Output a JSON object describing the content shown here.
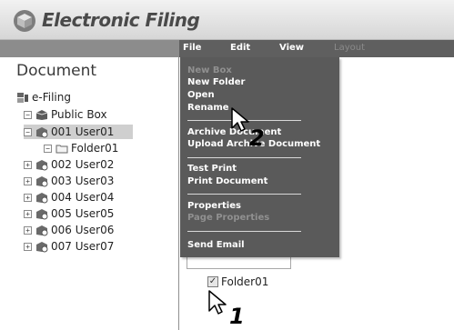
{
  "app": {
    "title": "Electronic Filing"
  },
  "menubar": {
    "items": [
      {
        "label": "File",
        "enabled": true
      },
      {
        "label": "Edit",
        "enabled": true
      },
      {
        "label": "View",
        "enabled": true
      },
      {
        "label": "Layout",
        "enabled": false
      }
    ]
  },
  "tree": {
    "heading": "Document",
    "root": "e-Filing",
    "public_box": "Public Box",
    "user01": "001 User01",
    "folder01": "Folder01",
    "user02": "002 User02",
    "user03": "003 User03",
    "user04": "004 User04",
    "user05": "005 User05",
    "user06": "006 User06",
    "user07": "007 User07",
    "expanded_symbol": "−",
    "collapsed_symbol": "+"
  },
  "file_menu": {
    "new_box": "New Box",
    "new_folder": "New Folder",
    "open": "Open",
    "rename": "Rename",
    "archive_document": "Archive Document",
    "upload_archive_document": "Upload Archive Document",
    "test_print": "Test Print",
    "print_document": "Print Document",
    "properties": "Properties",
    "page_properties": "Page Properties",
    "send_email": "Send Email"
  },
  "content": {
    "folder_name": "Folder01",
    "checkbox_checked": true,
    "check_mark": "✓"
  },
  "steps": {
    "first": "1",
    "second": "2"
  },
  "colors": {
    "menubar": "#5f5f5f",
    "dropdown": "#5a5a5a",
    "selection": "#cfcfcf",
    "disabled_text": "#909090"
  }
}
